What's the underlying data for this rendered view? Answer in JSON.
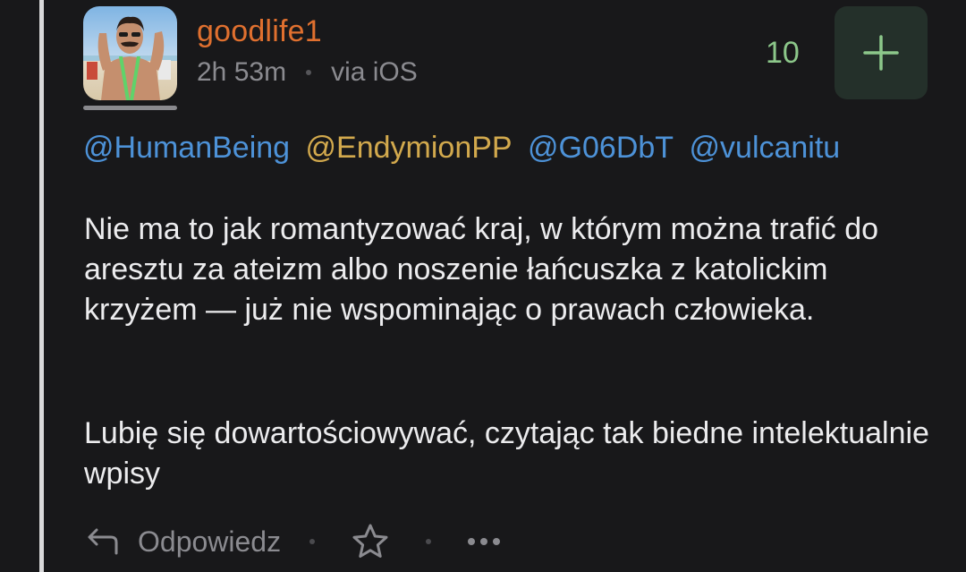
{
  "post": {
    "username": "goodlife1",
    "time_ago": "2h 53m",
    "via": "via iOS",
    "vote_count": "10",
    "mentions": [
      {
        "text": "@HumanBeing",
        "color": "#4d92d8"
      },
      {
        "text": "@EndymionPP",
        "color": "#d2a94d"
      },
      {
        "text": "@G06DbT",
        "color": "#4d92d8"
      },
      {
        "text": "@vulcanitu",
        "color": "#4d92d8"
      }
    ],
    "paragraphs": [
      "Nie ma to jak romantyzować kraj, w którym można trafić do aresztu za ateizm albo noszenie łańcuszka z katolickim krzyżem — już nie wspominając o prawach człowieka.",
      "Lubię się dowartościowywać, czytając tak biedne intelektualnie wpisy"
    ]
  },
  "actions": {
    "reply_label": "Odpowiedz",
    "reply_icon": "reply-arrow-icon",
    "favorite_icon": "star-icon",
    "more_icon": "more-dots-icon"
  },
  "colors": {
    "background": "#18181a",
    "username": "#e0702f",
    "vote": "#8cc78a",
    "plus_button_bg": "#24302a",
    "muted": "#8b8b90"
  }
}
